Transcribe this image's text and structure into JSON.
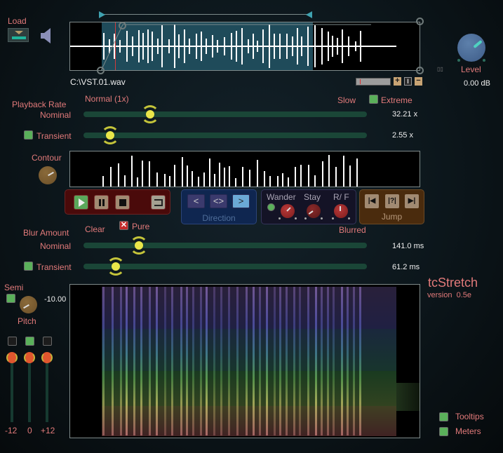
{
  "app": {
    "name": "tcStretch",
    "version_label": "version",
    "version": "0.5e"
  },
  "load": {
    "label": "Load"
  },
  "file": {
    "name": "C:\\VST.01.wav"
  },
  "level": {
    "label": "Level",
    "value": "0.00 dB",
    "meter_dots": "▯▯"
  },
  "zoom": {
    "plus": "+",
    "reset": "I",
    "minus": "−"
  },
  "playback": {
    "title": "Playback  Rate",
    "center_label": "Normal (1x)",
    "right_label": "Slow",
    "extreme_label": "Extreme",
    "extreme_checked": true,
    "nominal_label": "Nominal",
    "nominal_value": "32.21 x",
    "nominal_position": 0.2,
    "transient_label": "Transient",
    "transient_checked": true,
    "transient_value": "2.55 x",
    "transient_position": 0.06
  },
  "contour": {
    "label": "Contour"
  },
  "transport": {
    "play": "play",
    "pause": "pause",
    "stop": "stop",
    "loop": "loop"
  },
  "direction": {
    "label": "Direction",
    "back": "<",
    "both": "<>",
    "forward": ">",
    "active": "forward"
  },
  "wander": {
    "wander_label": "Wander",
    "stay_label": "Stay",
    "rf_label": "R/ F",
    "enabled": true
  },
  "jump": {
    "label": "Jump",
    "start": "|◀",
    "random": "|?|",
    "end": "▶|"
  },
  "blur": {
    "title": "Blur Amount",
    "left_label": "Clear",
    "pure_label": "Pure",
    "pure_checked": true,
    "right_label": "Blurred",
    "nominal_label": "Nominal",
    "nominal_value": "141.0 ms",
    "nominal_position": 0.16,
    "transient_label": "Transient",
    "transient_checked": true,
    "transient_value": "61.2 ms",
    "transient_position": 0.08
  },
  "pitch": {
    "semi_label": "Semi",
    "semi_checked": true,
    "value": "-10.00",
    "label": "Pitch",
    "sliders": [
      {
        "label": "-12",
        "checked": false
      },
      {
        "label": "0",
        "checked": true
      },
      {
        "label": "+12",
        "checked": false
      }
    ]
  },
  "options": {
    "tooltips_label": "Tooltips",
    "tooltips_checked": true,
    "meters_label": "Meters",
    "meters_checked": true
  }
}
